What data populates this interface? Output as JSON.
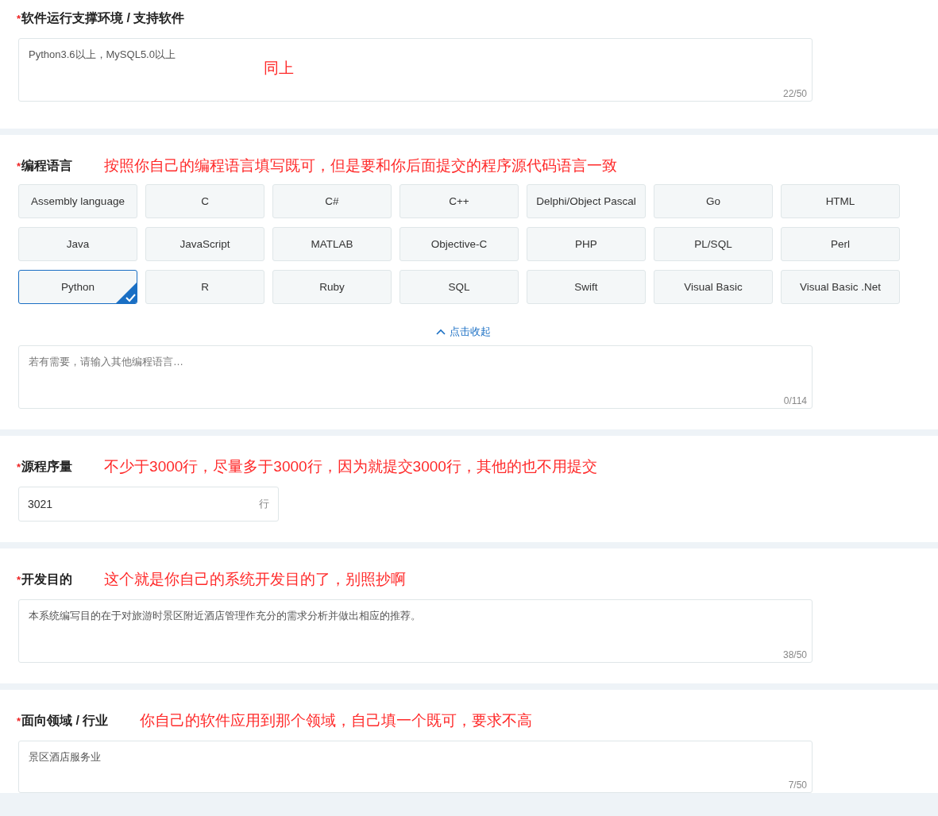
{
  "sections": [
    {
      "label": "软件运行支撑环境 / 支持软件",
      "required_mark": "*",
      "fields": [
        {
          "kind": "textarea",
          "value": "Python3.6以上，MySQL5.0以上",
          "counter": "22/50",
          "note": "同上"
        }
      ]
    },
    {
      "label": "编程语言",
      "required_mark": "*",
      "note": "按照你自己的编程语言填写既可，但是要和你后面提交的程序源代码语言一致",
      "options": [
        {
          "label": "Assembly language",
          "selected": false
        },
        {
          "label": "C",
          "selected": false
        },
        {
          "label": "C#",
          "selected": false
        },
        {
          "label": "C++",
          "selected": false
        },
        {
          "label": "Delphi/Object Pascal",
          "selected": false
        },
        {
          "label": "Go",
          "selected": false
        },
        {
          "label": "HTML",
          "selected": false
        },
        {
          "label": "Java",
          "selected": false
        },
        {
          "label": "JavaScript",
          "selected": false
        },
        {
          "label": "MATLAB",
          "selected": false
        },
        {
          "label": "Objective-C",
          "selected": false
        },
        {
          "label": "PHP",
          "selected": false
        },
        {
          "label": "PL/SQL",
          "selected": false
        },
        {
          "label": "Perl",
          "selected": false
        },
        {
          "label": "Python",
          "selected": true
        },
        {
          "label": "R",
          "selected": false
        },
        {
          "label": "Ruby",
          "selected": false
        },
        {
          "label": "SQL",
          "selected": false
        },
        {
          "label": "Swift",
          "selected": false
        },
        {
          "label": "Visual Basic",
          "selected": false
        },
        {
          "label": "Visual Basic .Net",
          "selected": false
        }
      ],
      "collapse_link": "点击收起",
      "fields": [
        {
          "kind": "textarea",
          "placeholder": "若有需要，请输入其他编程语言…",
          "counter": "0/114"
        }
      ]
    },
    {
      "label": "源程序量",
      "required_mark": "*",
      "note": "不少于3000行，尽量多于3000行，因为就提交3000行，其他的也不用提交",
      "fields": [
        {
          "kind": "input",
          "value": "3021",
          "suffix": "行"
        }
      ]
    },
    {
      "label": "开发目的",
      "required_mark": "*",
      "note": "这个就是你自己的系统开发目的了，别照抄啊",
      "fields": [
        {
          "kind": "textarea",
          "value": "本系统编写目的在于对旅游时景区附近酒店管理作充分的需求分析并做出相应的推荐。",
          "counter": "38/50"
        }
      ]
    },
    {
      "label": "面向领域 / 行业",
      "required_mark": "*",
      "note": "你自己的软件应用到那个领域，自己填一个既可，要求不高",
      "fields": [
        {
          "kind": "textarea",
          "value": "景区酒店服务业",
          "counter": "7/50"
        }
      ]
    }
  ]
}
